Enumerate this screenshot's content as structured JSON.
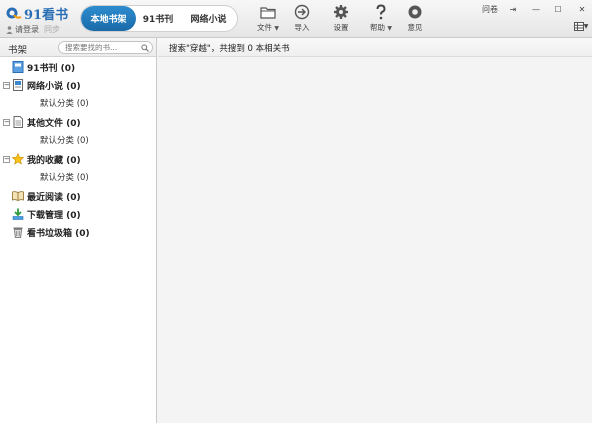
{
  "app": {
    "logo_text": "91看书",
    "login_text": "请登录",
    "sync_text": "同步"
  },
  "nav_tabs": [
    {
      "label": "本地书架",
      "active": true
    },
    {
      "label": "91书刊",
      "active": false
    },
    {
      "label": "网络小说",
      "active": false
    }
  ],
  "toolbar": {
    "file": "文件",
    "import": "导入",
    "settings": "设置",
    "help": "帮助",
    "feedback": "意见"
  },
  "window": {
    "ask": "问卷",
    "pin": "⇥",
    "minimize": "—",
    "maximize": "☐",
    "close": "✕"
  },
  "sidebar": {
    "title": "书架",
    "search_placeholder": "搜索要找的书...",
    "items": [
      {
        "label": "91书刊 (0)",
        "icon": "magazine-icon"
      },
      {
        "label": "网络小说 (0)",
        "icon": "novel-icon",
        "expander": "−"
      },
      {
        "label": "默认分类 (0)"
      },
      {
        "label": "其他文件 (0)",
        "icon": "document-icon",
        "expander": "−"
      },
      {
        "label": "默认分类 (0)"
      },
      {
        "label": "我的收藏 (0)",
        "icon": "star-icon",
        "expander": "−"
      },
      {
        "label": "默认分类 (0)"
      },
      {
        "label": "最近阅读 (0)",
        "icon": "open-book-icon"
      },
      {
        "label": "下载管理 (0)",
        "icon": "download-icon"
      },
      {
        "label": "看书垃圾箱 (0)",
        "icon": "trash-icon"
      }
    ]
  },
  "main": {
    "result_text": "搜索\"穿越\"，共搜到 0 本相关书"
  },
  "colors": {
    "accent": "#1f78bd",
    "logo": "#2a6fb5"
  }
}
